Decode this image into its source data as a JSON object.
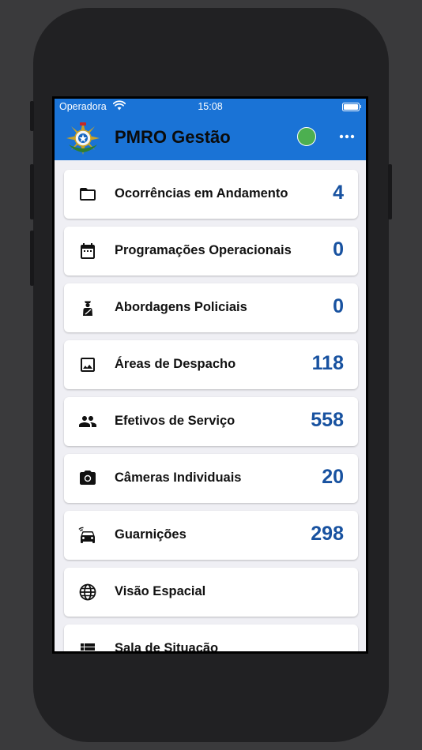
{
  "status_bar": {
    "carrier": "Operadora",
    "time": "15:08"
  },
  "app_bar": {
    "title": "PMRO Gestão",
    "status_color": "#4caf50",
    "brand_color": "#1a73d6"
  },
  "items": [
    {
      "label": "Ocorrências em Andamento",
      "count": "4",
      "icon": "folder-icon"
    },
    {
      "label": "Programações Operacionais",
      "count": "0",
      "icon": "calendar-icon"
    },
    {
      "label": "Abordagens Policiais",
      "count": "0",
      "icon": "police-officer-icon"
    },
    {
      "label": "Áreas de Despacho",
      "count": "118",
      "icon": "image-icon"
    },
    {
      "label": "Efetivos de Serviço",
      "count": "558",
      "icon": "people-icon"
    },
    {
      "label": "Câmeras Individuais",
      "count": "20",
      "icon": "camera-icon"
    },
    {
      "label": "Guarnições",
      "count": "298",
      "icon": "connected-car-icon"
    },
    {
      "label": "Visão Espacial",
      "count": "",
      "icon": "globe-icon"
    },
    {
      "label": "Sala de Situação",
      "count": "",
      "icon": "view-list-icon"
    }
  ]
}
